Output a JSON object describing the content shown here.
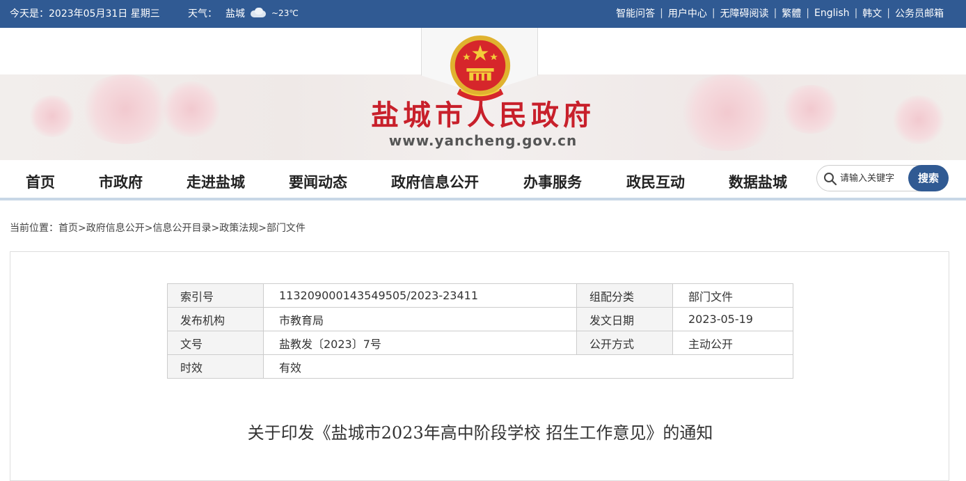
{
  "topbar": {
    "date": "今天是：2023年05月31日 星期三",
    "weather_label": "天气：",
    "weather_city": "盐城",
    "weather_temp": "~23℃",
    "links": [
      "智能问答",
      "用户中心",
      "无障碍阅读",
      "繁體",
      "English",
      "韩文",
      "公务员邮箱"
    ]
  },
  "header": {
    "site_title": "盐城市人民政府",
    "site_url": "www.yancheng.gov.cn"
  },
  "nav": {
    "items": [
      "首页",
      "市政府",
      "走进盐城",
      "要闻动态",
      "政府信息公开",
      "办事服务",
      "政民互动",
      "数据盐城"
    ],
    "search_placeholder": "请输入关键字",
    "search_button": "搜索"
  },
  "breadcrumb": {
    "label": "当前位置：",
    "items": [
      "首页",
      "政府信息公开",
      "信息公开目录",
      "政策法规",
      "部门文件"
    ],
    "separator": ">"
  },
  "meta": {
    "index_label": "索引号",
    "index_value": "113209000143549505/2023-23411",
    "category_label": "组配分类",
    "category_value": "部门文件",
    "org_label": "发布机构",
    "org_value": "市教育局",
    "date_label": "发文日期",
    "date_value": "2023-05-19",
    "docno_label": "文号",
    "docno_value": "盐教发〔2023〕7号",
    "method_label": "公开方式",
    "method_value": "主动公开",
    "validity_label": "时效",
    "validity_value": "有效"
  },
  "document": {
    "title": "关于印发《盐城市2023年高中阶段学校 招生工作意见》的通知"
  },
  "colors": {
    "topbar": "#305a93",
    "title_red": "#c8202b",
    "nav_underline": "#c8d7e6"
  }
}
